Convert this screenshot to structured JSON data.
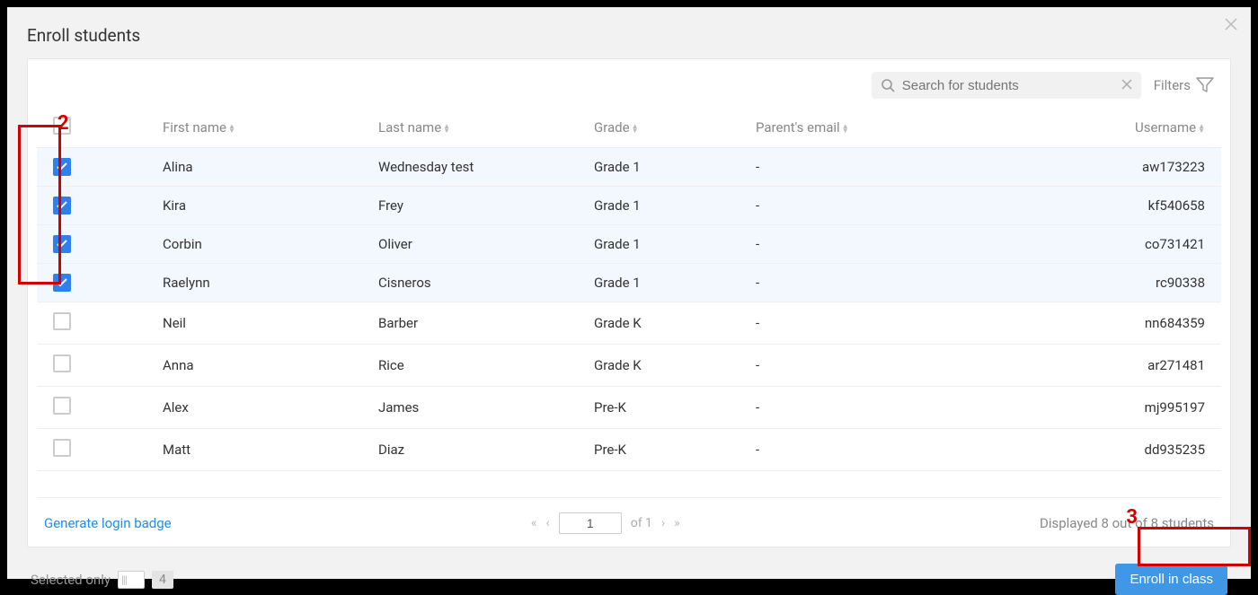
{
  "modal": {
    "title": "Enroll students",
    "search_placeholder": "Search for students",
    "filters_label": "Filters"
  },
  "columns": {
    "first": "First name",
    "last": "Last name",
    "grade": "Grade",
    "parent": "Parent's email",
    "user": "Username"
  },
  "rows": [
    {
      "selected": true,
      "first": "Alina",
      "last": "Wednesday test",
      "grade": "Grade 1",
      "parent": "-",
      "user": "aw173223"
    },
    {
      "selected": true,
      "first": "Kira",
      "last": "Frey",
      "grade": "Grade 1",
      "parent": "-",
      "user": "kf540658"
    },
    {
      "selected": true,
      "first": "Corbin",
      "last": "Oliver",
      "grade": "Grade 1",
      "parent": "-",
      "user": "co731421"
    },
    {
      "selected": true,
      "first": "Raelynn",
      "last": "Cisneros",
      "grade": "Grade 1",
      "parent": "-",
      "user": "rc90338"
    },
    {
      "selected": false,
      "first": "Neil",
      "last": "Barber",
      "grade": "Grade K",
      "parent": "-",
      "user": "nn684359"
    },
    {
      "selected": false,
      "first": "Anna",
      "last": "Rice",
      "grade": "Grade K",
      "parent": "-",
      "user": "ar271481"
    },
    {
      "selected": false,
      "first": "Alex",
      "last": "James",
      "grade": "Pre-K",
      "parent": "-",
      "user": "mj995197"
    },
    {
      "selected": false,
      "first": "Matt",
      "last": "Diaz",
      "grade": "Pre-K",
      "parent": "-",
      "user": "dd935235"
    }
  ],
  "footer": {
    "generate_link": "Generate login badge",
    "page_current": "1",
    "page_total_label": "of 1",
    "displayed_text": "Displayed 8 out of 8 students"
  },
  "bottom": {
    "selected_only_label": "Selected only",
    "selected_count": "4",
    "enroll_label": "Enroll in class"
  },
  "annotations": {
    "a2": "2",
    "a3": "3"
  }
}
